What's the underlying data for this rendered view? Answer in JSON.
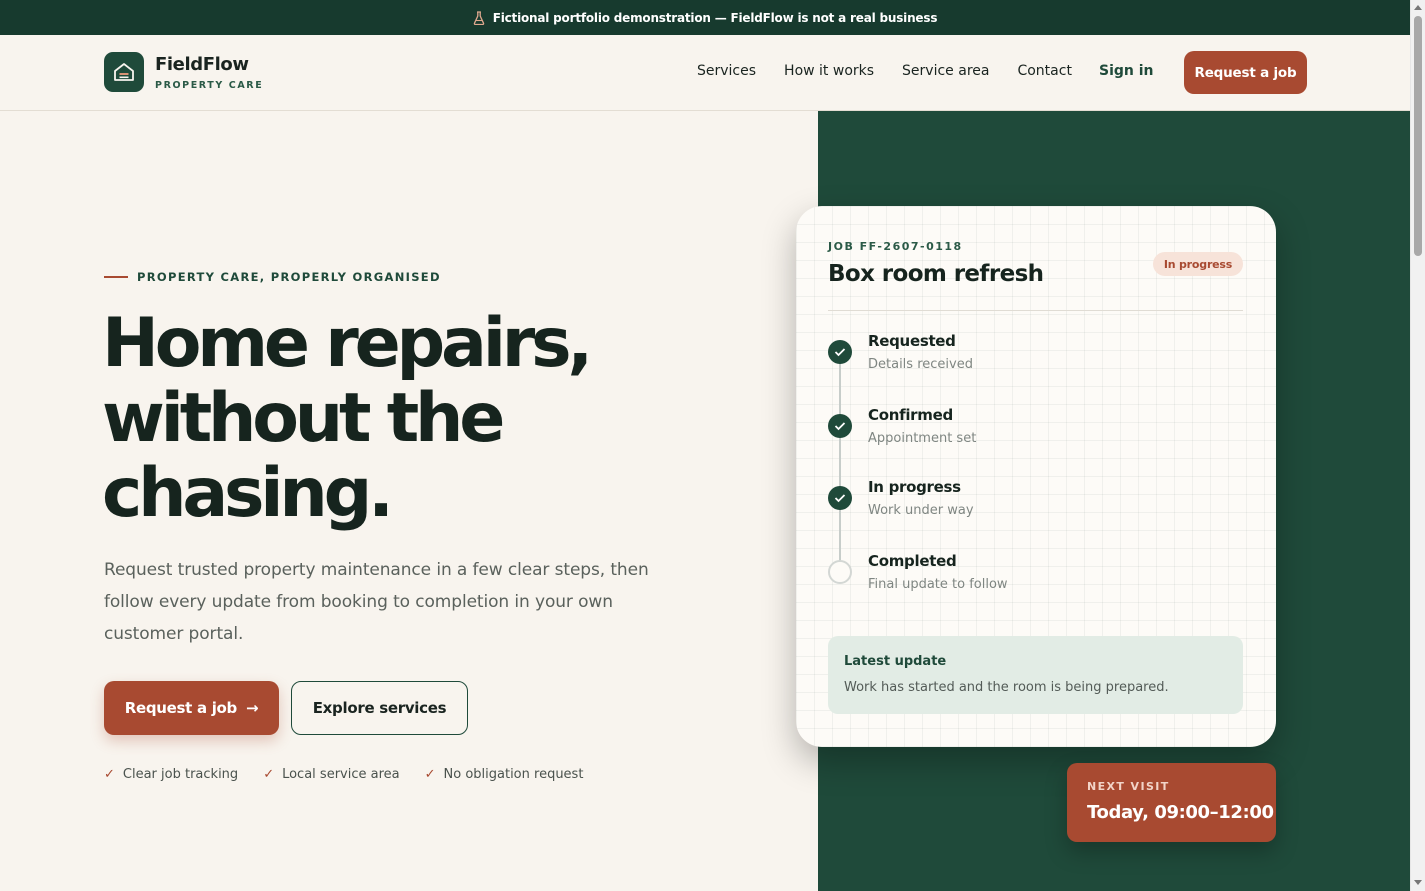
{
  "banner": {
    "text": "Fictional portfolio demonstration — FieldFlow is not a real business",
    "icon": "flask-icon"
  },
  "header": {
    "brand_name": "FieldFlow",
    "brand_sub": "PROPERTY CARE",
    "nav": [
      "Services",
      "How it works",
      "Service area",
      "Contact"
    ],
    "sign_in": "Sign in",
    "cta": "Request a job"
  },
  "hero": {
    "eyebrow": "PROPERTY CARE, PROPERLY ORGANISED",
    "headline_lines": [
      "Home repairs,",
      "without the",
      "chasing."
    ],
    "lead": "Request trusted property maintenance in a few clear steps, then follow every update from booking to completion in your own customer portal.",
    "primary_button": "Request a job",
    "secondary_button": "Explore services",
    "perks": [
      "Clear job tracking",
      "Local service area",
      "No obligation request"
    ]
  },
  "job_card": {
    "job_id": "JOB FF-2607-0118",
    "title": "Box room refresh",
    "status": "In progress",
    "steps": [
      {
        "title": "Requested",
        "subtitle": "Details received",
        "done": true
      },
      {
        "title": "Confirmed",
        "subtitle": "Appointment set",
        "done": true
      },
      {
        "title": "In progress",
        "subtitle": "Work under way",
        "done": true
      },
      {
        "title": "Completed",
        "subtitle": "Final update to follow",
        "done": false
      }
    ],
    "update_title": "Latest update",
    "update_text": "Work has started and the room is being prepared."
  },
  "next_visit": {
    "label": "NEXT VISIT",
    "time": "Today, 09:00–12:00"
  },
  "colors": {
    "brand_green": "#1f4a3a",
    "banner_green": "#173a2e",
    "accent_rust": "#a84a31",
    "background": "#f8f4ee"
  }
}
